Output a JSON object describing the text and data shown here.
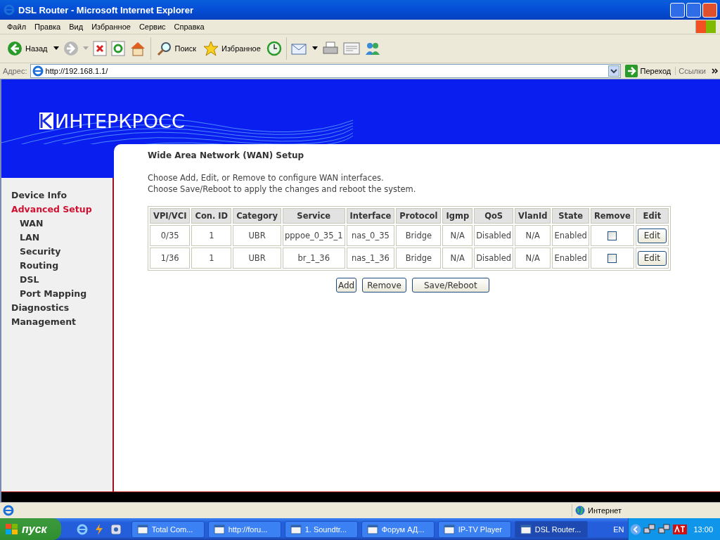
{
  "window": {
    "title": "DSL Router - Microsoft Internet Explorer"
  },
  "menu": [
    "Файл",
    "Правка",
    "Вид",
    "Избранное",
    "Сервис",
    "Справка"
  ],
  "toolbar": {
    "back": "Назад",
    "search": "Поиск",
    "favorites": "Избранное"
  },
  "address_bar": {
    "label": "Адрес:",
    "url": "http://192.168.1.1/",
    "go": "Переход",
    "links": "Ссылки"
  },
  "page": {
    "logo": "ИНТЕРКРОСС",
    "sidebar": [
      {
        "label": "Device Info",
        "selected": false
      },
      {
        "label": "Advanced Setup",
        "selected": true,
        "children": [
          {
            "label": "WAN",
            "selected": false
          },
          {
            "label": "LAN",
            "selected": false
          },
          {
            "label": "Security",
            "selected": false
          },
          {
            "label": "Routing",
            "selected": false
          },
          {
            "label": "DSL",
            "selected": false
          },
          {
            "label": "Port Mapping",
            "selected": false
          }
        ]
      },
      {
        "label": "Diagnostics",
        "selected": false
      },
      {
        "label": "Management",
        "selected": false
      }
    ],
    "heading": "Wide Area Network (WAN) Setup",
    "instructions": [
      "Choose Add, Edit, or Remove to configure WAN interfaces.",
      "Choose Save/Reboot to apply the changes and reboot the system."
    ],
    "table": {
      "columns": [
        "VPI/VCI",
        "Con. ID",
        "Category",
        "Service",
        "Interface",
        "Protocol",
        "Igmp",
        "QoS",
        "VlanId",
        "State",
        "Remove",
        "Edit"
      ],
      "rows": [
        {
          "cells": [
            "0/35",
            "1",
            "UBR",
            "pppoe_0_35_1",
            "nas_0_35",
            "Bridge",
            "N/A",
            "Disabled",
            "N/A",
            "Enabled"
          ],
          "remove": false,
          "edit": "Edit"
        },
        {
          "cells": [
            "1/36",
            "1",
            "UBR",
            "br_1_36",
            "nas_1_36",
            "Bridge",
            "N/A",
            "Disabled",
            "N/A",
            "Enabled"
          ],
          "remove": false,
          "edit": "Edit"
        }
      ]
    },
    "buttons": [
      "Add",
      "Remove",
      "Save/Reboot"
    ]
  },
  "status_bar": {
    "zone": "Интернет"
  },
  "taskbar": {
    "start": "пуск",
    "tasks": [
      {
        "label": "Total Com...",
        "selected": false
      },
      {
        "label": "http://foru...",
        "selected": false
      },
      {
        "label": "1. Soundtr...",
        "selected": false
      },
      {
        "label": "Форум АД...",
        "selected": false
      },
      {
        "label": "IP-TV Player",
        "selected": false
      },
      {
        "label": "DSL Router...",
        "selected": true
      }
    ],
    "language": "EN",
    "clock": "13:00"
  }
}
